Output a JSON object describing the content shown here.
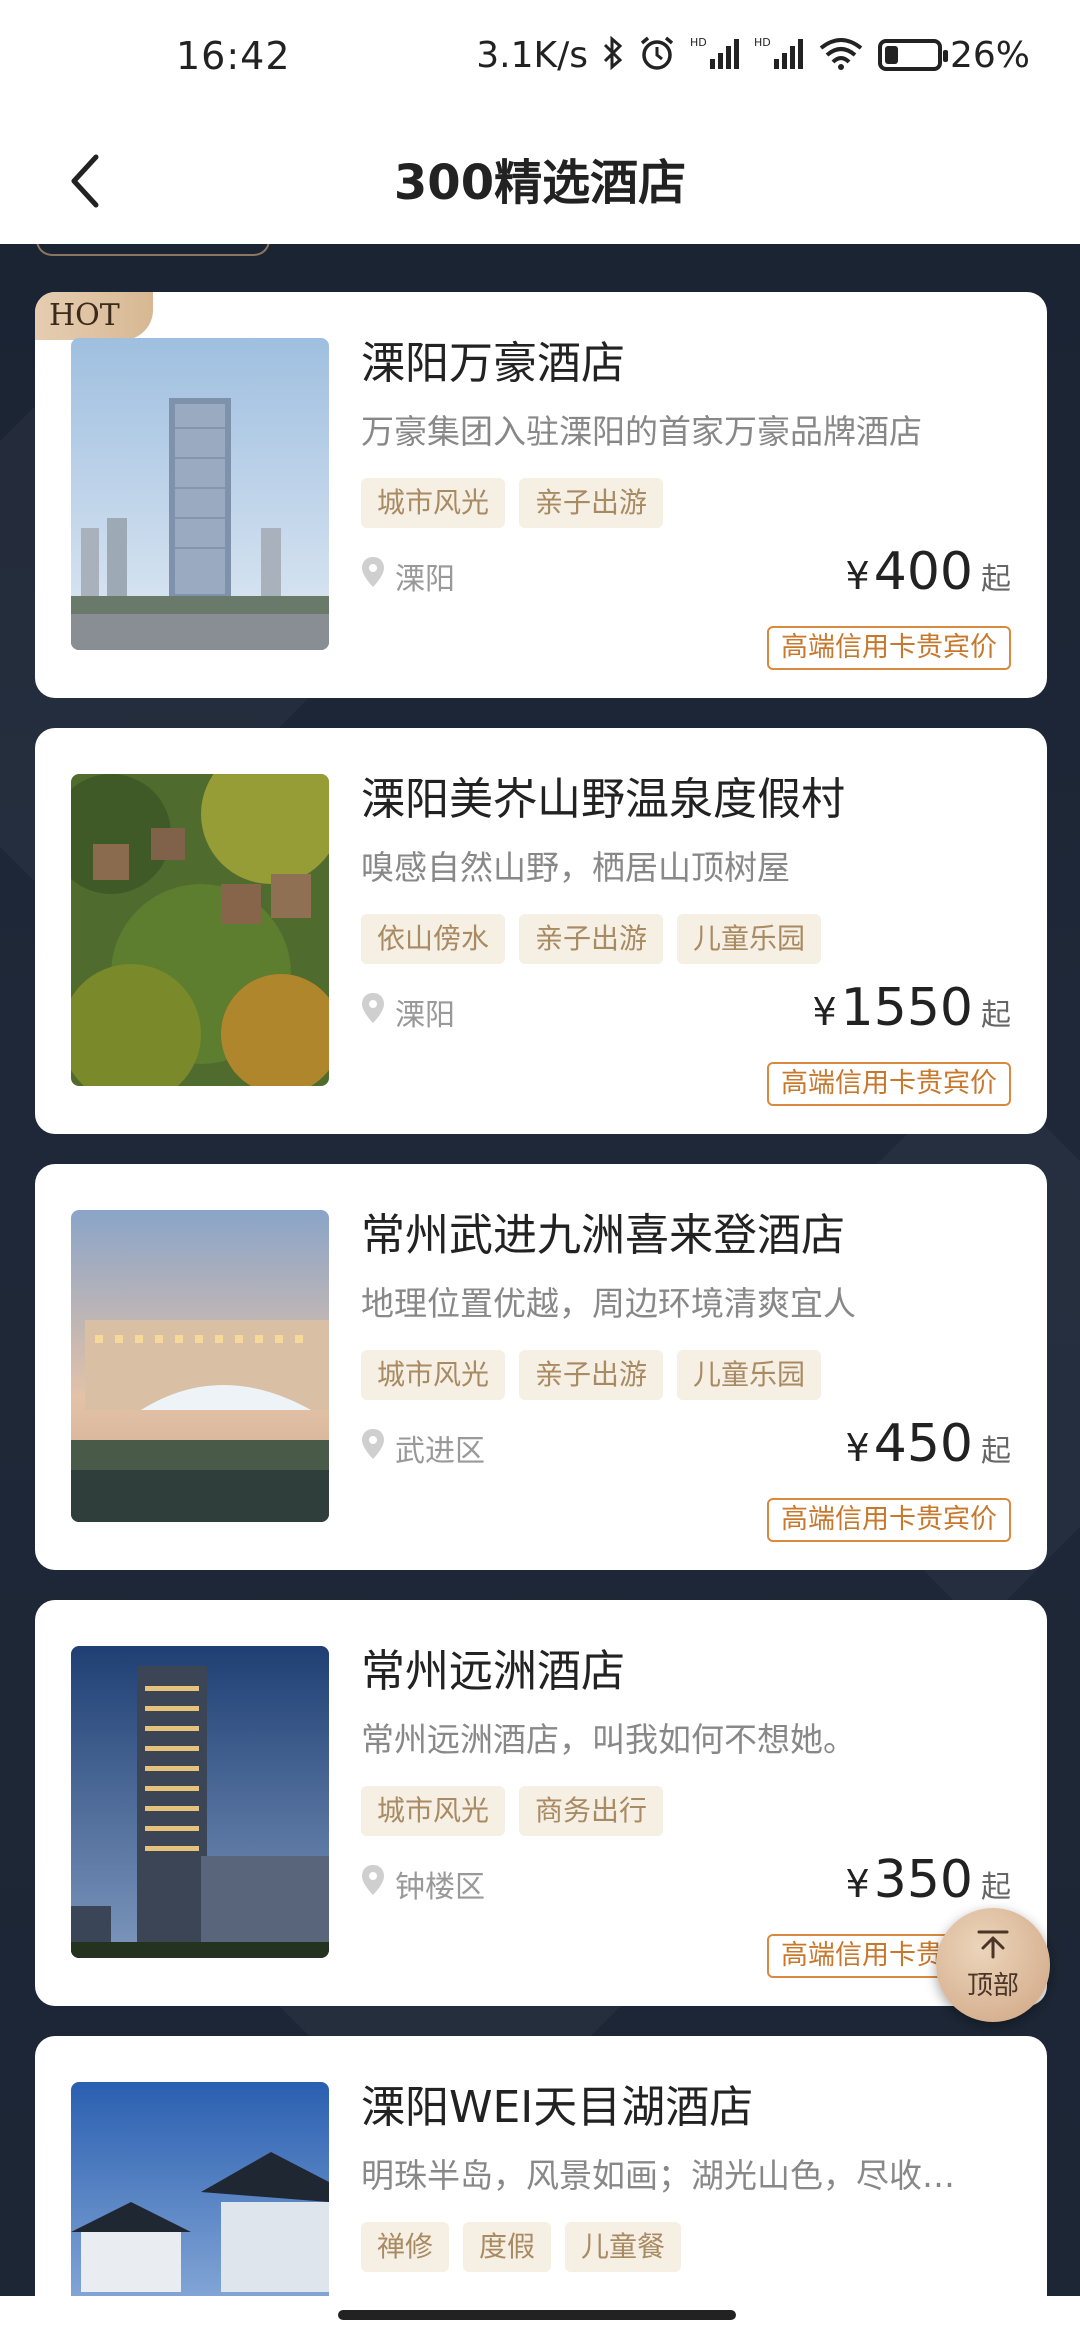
{
  "status_bar": {
    "time": "16:42",
    "net_speed": "3.1K/s",
    "battery": "26%",
    "battery_level": 0.26,
    "icons": [
      "bluetooth-icon",
      "alarm-icon",
      "hd-signal-icon",
      "hd-signal-icon",
      "wifi-icon",
      "battery-icon"
    ]
  },
  "nav": {
    "title": "300精选酒店",
    "back_icon": "chevron-left-icon"
  },
  "hotels": [
    {
      "name": "溧阳万豪酒店",
      "desc": "万豪集团入驻溧阳的首家万豪品牌酒店",
      "tags": [
        "城市风光",
        "亲子出游"
      ],
      "location": "溧阳",
      "currency": "¥",
      "price": "400",
      "price_suffix": "起",
      "perk": "高端信用卡贵宾价",
      "badge": "HOT"
    },
    {
      "name": "溧阳美岕山野温泉度假村",
      "desc": "嗅感自然山野，栖居山顶树屋",
      "tags": [
        "依山傍水",
        "亲子出游",
        "儿童乐园"
      ],
      "location": "溧阳",
      "currency": "¥",
      "price": "1550",
      "price_suffix": "起",
      "perk": "高端信用卡贵宾价"
    },
    {
      "name": "常州武进九洲喜来登酒店",
      "desc": "地理位置优越，周边环境清爽宜人",
      "tags": [
        "城市风光",
        "亲子出游",
        "儿童乐园"
      ],
      "location": "武进区",
      "currency": "¥",
      "price": "450",
      "price_suffix": "起",
      "perk": "高端信用卡贵宾价"
    },
    {
      "name": "常州远洲酒店",
      "desc": "常州远洲酒店，叫我如何不想她。",
      "tags": [
        "城市风光",
        "商务出行"
      ],
      "location": "钟楼区",
      "currency": "¥",
      "price": "350",
      "price_suffix": "起",
      "perk": "高端信用卡贵宾价"
    },
    {
      "name": "溧阳WEI天目湖酒店",
      "desc": "明珠半岛，风景如画；湖光山色，尽收…",
      "tags": [
        "禅修",
        "度假",
        "儿童餐"
      ]
    }
  ],
  "top_button": {
    "label": "顶部",
    "icon": "arrow-up-icon"
  }
}
